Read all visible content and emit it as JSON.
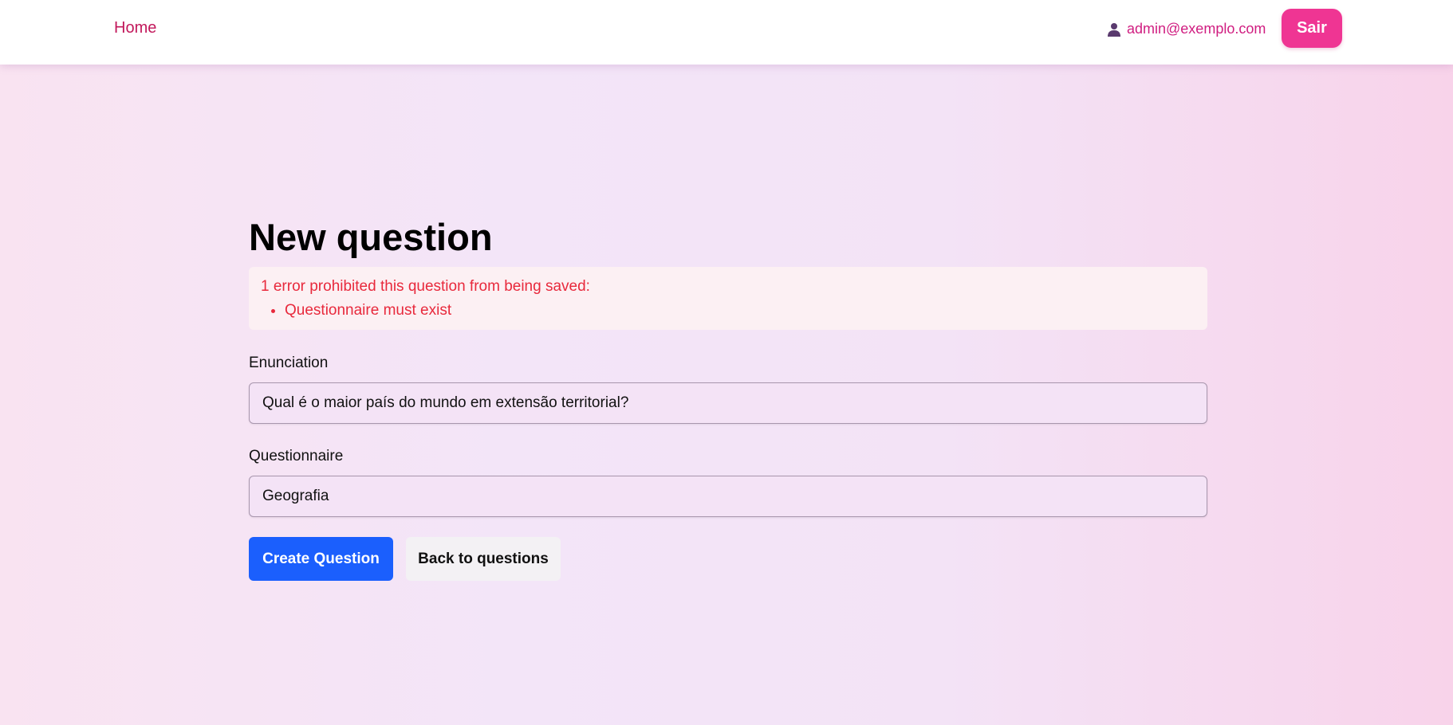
{
  "nav": {
    "home_label": "Home",
    "user_icon": "user-icon",
    "user_email": "admin@exemplo.com",
    "logout_label": "Sair"
  },
  "page": {
    "title": "New question"
  },
  "errors": {
    "header": "1 error prohibited this question from being saved:",
    "items": [
      "Questionnaire must exist"
    ]
  },
  "form": {
    "enunciation_label": "Enunciation",
    "enunciation_value": "Qual é o maior país do mundo em extensão territorial?",
    "questionnaire_label": "Questionnaire",
    "questionnaire_value": "Geografia",
    "submit_label": "Create Question",
    "back_label": "Back to questions"
  },
  "colors": {
    "brand_pink": "#ef3593",
    "link_pink": "#c2185b",
    "primary_blue": "#1b5ffd",
    "error_red": "#e8293c"
  }
}
